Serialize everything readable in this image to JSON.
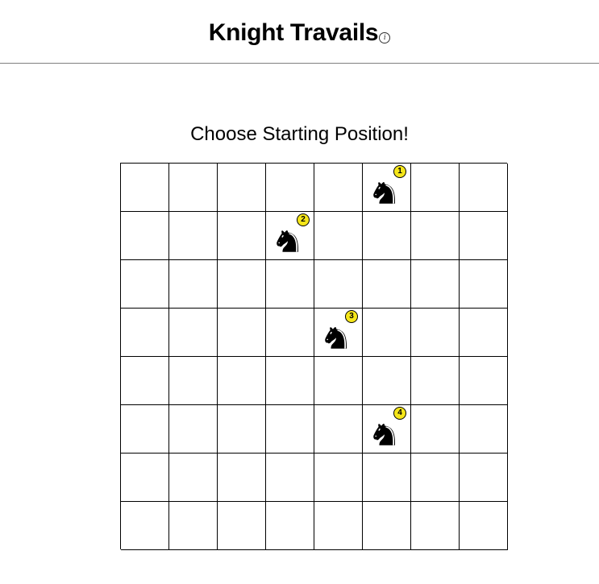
{
  "header": {
    "title": "Knight Travails",
    "info_icon": "info-icon"
  },
  "prompt": "Choose Starting Position!",
  "board": {
    "rows": 8,
    "cols": 8,
    "knights": [
      {
        "row": 0,
        "col": 5,
        "order": "1"
      },
      {
        "row": 1,
        "col": 3,
        "order": "2"
      },
      {
        "row": 3,
        "col": 4,
        "order": "3"
      },
      {
        "row": 5,
        "col": 5,
        "order": "4"
      }
    ],
    "knight_icon": "knight-icon",
    "badge_color": "#f5e61a"
  }
}
